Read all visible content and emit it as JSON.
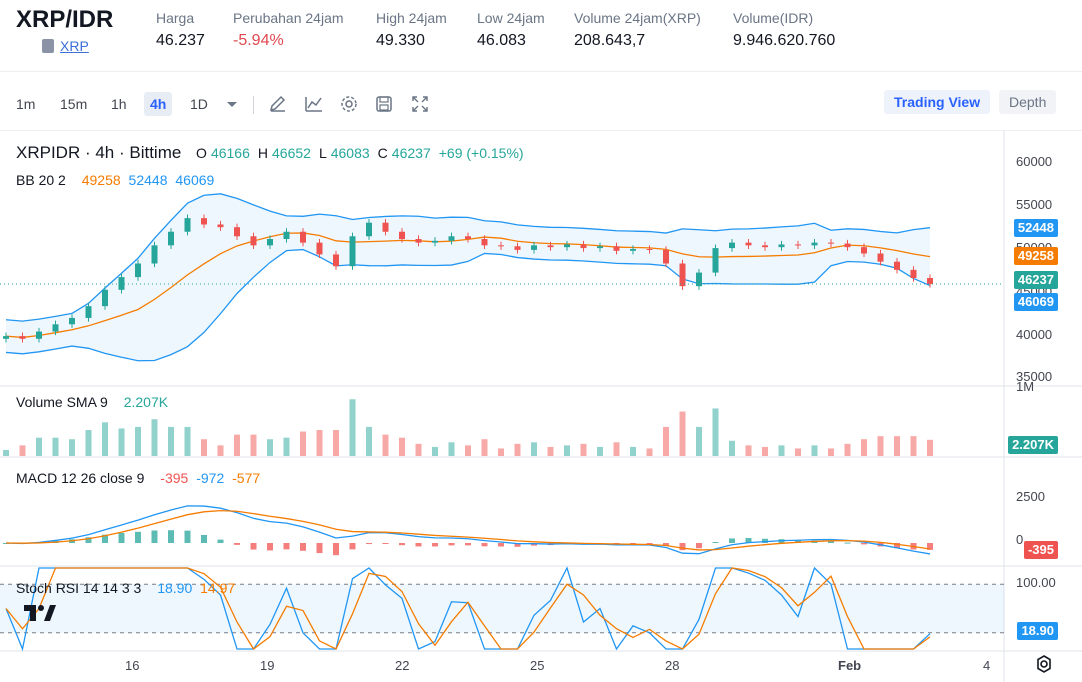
{
  "header": {
    "pair": "XRP/IDR",
    "coin_link": "XRP",
    "stats": [
      {
        "label": "Harga",
        "value": "46.237",
        "negative": false
      },
      {
        "label": "Perubahan 24jam",
        "value": "-5.94%",
        "negative": true
      },
      {
        "label": "High 24jam",
        "value": "49.330",
        "negative": false
      },
      {
        "label": "Low 24jam",
        "value": "46.083",
        "negative": false
      },
      {
        "label": "Volume 24jam(XRP)",
        "value": "208.643,7",
        "negative": false
      },
      {
        "label": "Volume(IDR)",
        "value": "9.946.620.760",
        "negative": false
      }
    ]
  },
  "toolbar": {
    "timeframes": [
      "1m",
      "15m",
      "1h",
      "4h",
      "1D"
    ],
    "active_timeframe": "4h",
    "icons": [
      "chevron-down-icon",
      "draw-icon",
      "indicator-icon",
      "settings-icon",
      "save-icon",
      "fullscreen-icon"
    ],
    "tabs": {
      "trading_view": "Trading View",
      "depth": "Depth"
    }
  },
  "legend": {
    "symbol": "XRPIDR · 4h · Bittime",
    "o_label": "O",
    "o": "46166",
    "h_label": "H",
    "h": "46652",
    "l_label": "L",
    "l": "46083",
    "c_label": "C",
    "c": "46237",
    "change": "+69 (+0.15%)",
    "bb_label": "BB 20 2",
    "bb_basis": "49258",
    "bb_upper": "52448",
    "bb_lower": "46069",
    "vol_label": "Volume SMA 9",
    "vol_value": "2.207K",
    "macd_label": "MACD 12 26 close 9",
    "macd_hist": "-395",
    "macd_line": "-972",
    "macd_signal": "-577",
    "stoch_label": "Stoch RSI 14 14 3 3",
    "stoch_k": "18.90",
    "stoch_d": "14.97"
  },
  "price_axis": {
    "ticks": [
      "60000",
      "55000",
      "50000",
      "45000",
      "40000",
      "35000"
    ],
    "tags": {
      "upper": "52448",
      "basis": "49258",
      "last": "46237",
      "lower": "46069"
    }
  },
  "volume_axis": {
    "tick": "1M",
    "tag": "2.207K"
  },
  "macd_axis": {
    "tick": "2500",
    "zero": "0",
    "tag": "-395"
  },
  "stoch_axis": {
    "top": "100.00",
    "tag": "18.90"
  },
  "date_axis": [
    "16",
    "19",
    "22",
    "25",
    "28",
    "Feb",
    "4"
  ],
  "colors": {
    "up": "#26a69a",
    "down": "#ef5350",
    "bb_band": "#2196f3",
    "bb_basis": "#f57c00",
    "macd": "#2196f3",
    "signal": "#f57c00",
    "accent": "#2962ff"
  },
  "chart_data": {
    "type": "candlestick",
    "symbol": "XRPIDR",
    "interval": "4h",
    "x": [
      "16",
      "19",
      "22",
      "25",
      "28",
      "Feb",
      "4"
    ],
    "ylim": [
      35000,
      62000
    ],
    "close_series": [
      40500,
      40200,
      41000,
      41800,
      42500,
      43800,
      45600,
      47000,
      48500,
      50500,
      52000,
      53500,
      52800,
      52500,
      51500,
      50500,
      51200,
      52000,
      50800,
      49500,
      48200,
      51500,
      53000,
      52000,
      51200,
      50800,
      51000,
      51500,
      51200,
      50500,
      50400,
      50000,
      50500,
      50300,
      50600,
      50200,
      50400,
      49900,
      50100,
      50000,
      48500,
      46000,
      47500,
      50200,
      50800,
      50500,
      50300,
      50600,
      50500,
      50800,
      50700,
      50300,
      49600,
      48700,
      47800,
      46900,
      46237
    ],
    "bb_upper_last": 52448,
    "bb_basis_last": 49258,
    "bb_lower_last": 46069,
    "volume_sma": 2207,
    "macd": {
      "hist": -395,
      "macd": -972,
      "signal": -577
    },
    "stoch_rsi": {
      "k": 18.9,
      "d": 14.97,
      "upper_band": 80,
      "lower_band": 20
    }
  }
}
